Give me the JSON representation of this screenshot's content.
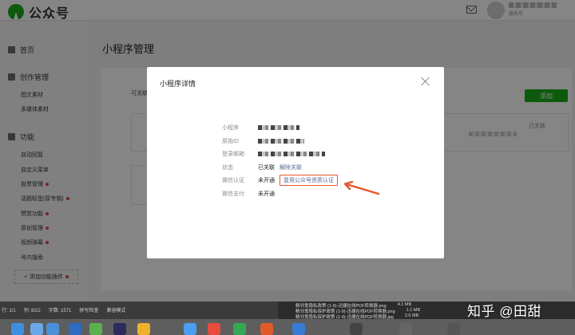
{
  "header": {
    "app_title": "公众号",
    "account_type": "服务号"
  },
  "sidebar": {
    "groups": [
      {
        "label": "首页"
      },
      {
        "label": "创作管理"
      },
      {
        "label": "功能"
      }
    ],
    "items": [
      {
        "label": "图文素材"
      },
      {
        "label": "多媒体素材"
      },
      {
        "label": "自动回复"
      },
      {
        "label": "自定义菜单"
      },
      {
        "label": "投票管理"
      },
      {
        "label": "话题标签(原专辑)"
      },
      {
        "label": "赞赏功能"
      },
      {
        "label": "原创管理"
      },
      {
        "label": "视频弹幕"
      },
      {
        "label": "号内搜索"
      }
    ],
    "add_plugin": "添加功能插件"
  },
  "main": {
    "page_title": "小程序管理",
    "hint": "可关联",
    "add_button": "添加",
    "linked_tag": "已关联"
  },
  "dialog": {
    "title": "小程序详情",
    "rows": {
      "name_label": "小程序",
      "id_label": "原始ID",
      "email_label": "登录邮箱",
      "status_label": "状态",
      "status_value": "已关联",
      "unlink": "解除关联",
      "verify_label": "微信认证",
      "verify_value": "未开通",
      "reuse_verify": "复用公众号资质认证",
      "pay_label": "微信支付",
      "pay_value": "未开通"
    }
  },
  "statusbar": {
    "line": "行: 1/1",
    "col": "列: 8/22",
    "chars": "字数: 1571",
    "spell": "拼写检查",
    "compat": "兼容模式"
  },
  "files": [
    {
      "name": "精邻鬼隐私政策 (1-8)-迅捷在线PDF转换器.png",
      "size": "4.1 MB"
    },
    {
      "name": "精邻鬼隐私保护政策 (1-9)-迅捷在线PDF转换器.png",
      "size": "1.1 MB"
    },
    {
      "name": "精邻鬼隐私保护政策 (1-9)-迅捷在线PDF转换器.jpg",
      "size": "2.6 MB"
    }
  ],
  "watermark": "知乎 @田甜",
  "colors": {
    "brand_green": "#1aad19",
    "link": "#576b95",
    "annotation": "#e8552b",
    "reddot": "#e64340"
  }
}
